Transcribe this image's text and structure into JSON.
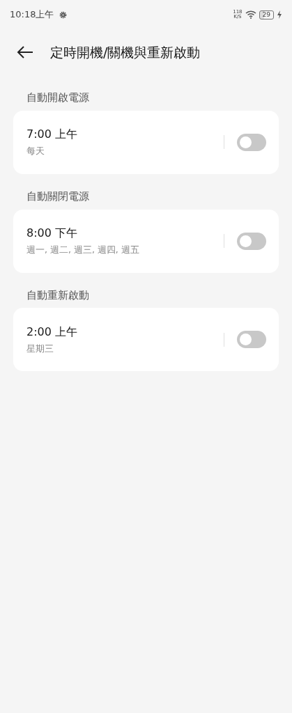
{
  "status_bar": {
    "time": "10:18上午",
    "speed_value": "118",
    "speed_unit": "K/S",
    "battery": "29",
    "charging": true
  },
  "header": {
    "title": "定時開機/關機與重新啟動"
  },
  "sections": [
    {
      "label": "自動開啟電源",
      "time": "7:00 上午",
      "repeat": "每天",
      "on": false
    },
    {
      "label": "自動關閉電源",
      "time": "8:00 下午",
      "repeat": "週一, 週二, 週三, 週四, 週五",
      "on": false
    },
    {
      "label": "自動重新啟動",
      "time": "2:00 上午",
      "repeat": "星期三",
      "on": false
    }
  ]
}
